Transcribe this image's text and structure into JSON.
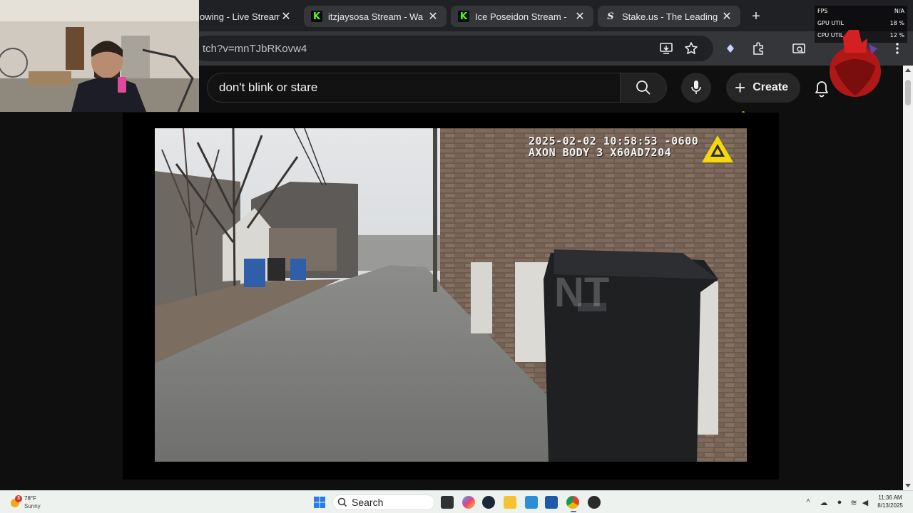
{
  "browser": {
    "tabs": [
      {
        "title": "Following - Live Streams",
        "favicon": "twitch-icon",
        "visible_title": "owing - Live Stream"
      },
      {
        "title": "itzjaysosa Stream - Wa",
        "favicon": "kick-icon",
        "glyph": "K"
      },
      {
        "title": "Ice Poseidon Stream -",
        "favicon": "kick-icon",
        "glyph": "K"
      },
      {
        "title": "Stake.us - The Leading",
        "favicon": "stake-icon",
        "glyph": "S"
      }
    ],
    "close_glyph": "✕",
    "new_tab_glyph": "+",
    "address": "tch?v=mnTJbRKovw4"
  },
  "youtube": {
    "search_query": "don't blink or stare",
    "create_label": "Create"
  },
  "video": {
    "timestamp": "2025-02-02 10:58:53 -0600",
    "device": "AXON BODY 3 X60AD7204",
    "watermark": "NT"
  },
  "stats_overlay": {
    "rows": [
      {
        "label": "FPS",
        "value": "N/A"
      },
      {
        "label": "GPU UTIL",
        "value": "18 %"
      },
      {
        "label": "CPU UTIL",
        "value": "12 %"
      }
    ]
  },
  "taskbar": {
    "weather_temp": "78°F",
    "weather_cond": "Sunny",
    "weather_badge": "3",
    "search_label": "Search",
    "time": "11:36 AM",
    "date": "8/13/2025"
  },
  "colors": {
    "kick_green": "#53fc18",
    "youtube_bg": "#0f0f0f",
    "axon_yellow": "#f5d90a"
  }
}
